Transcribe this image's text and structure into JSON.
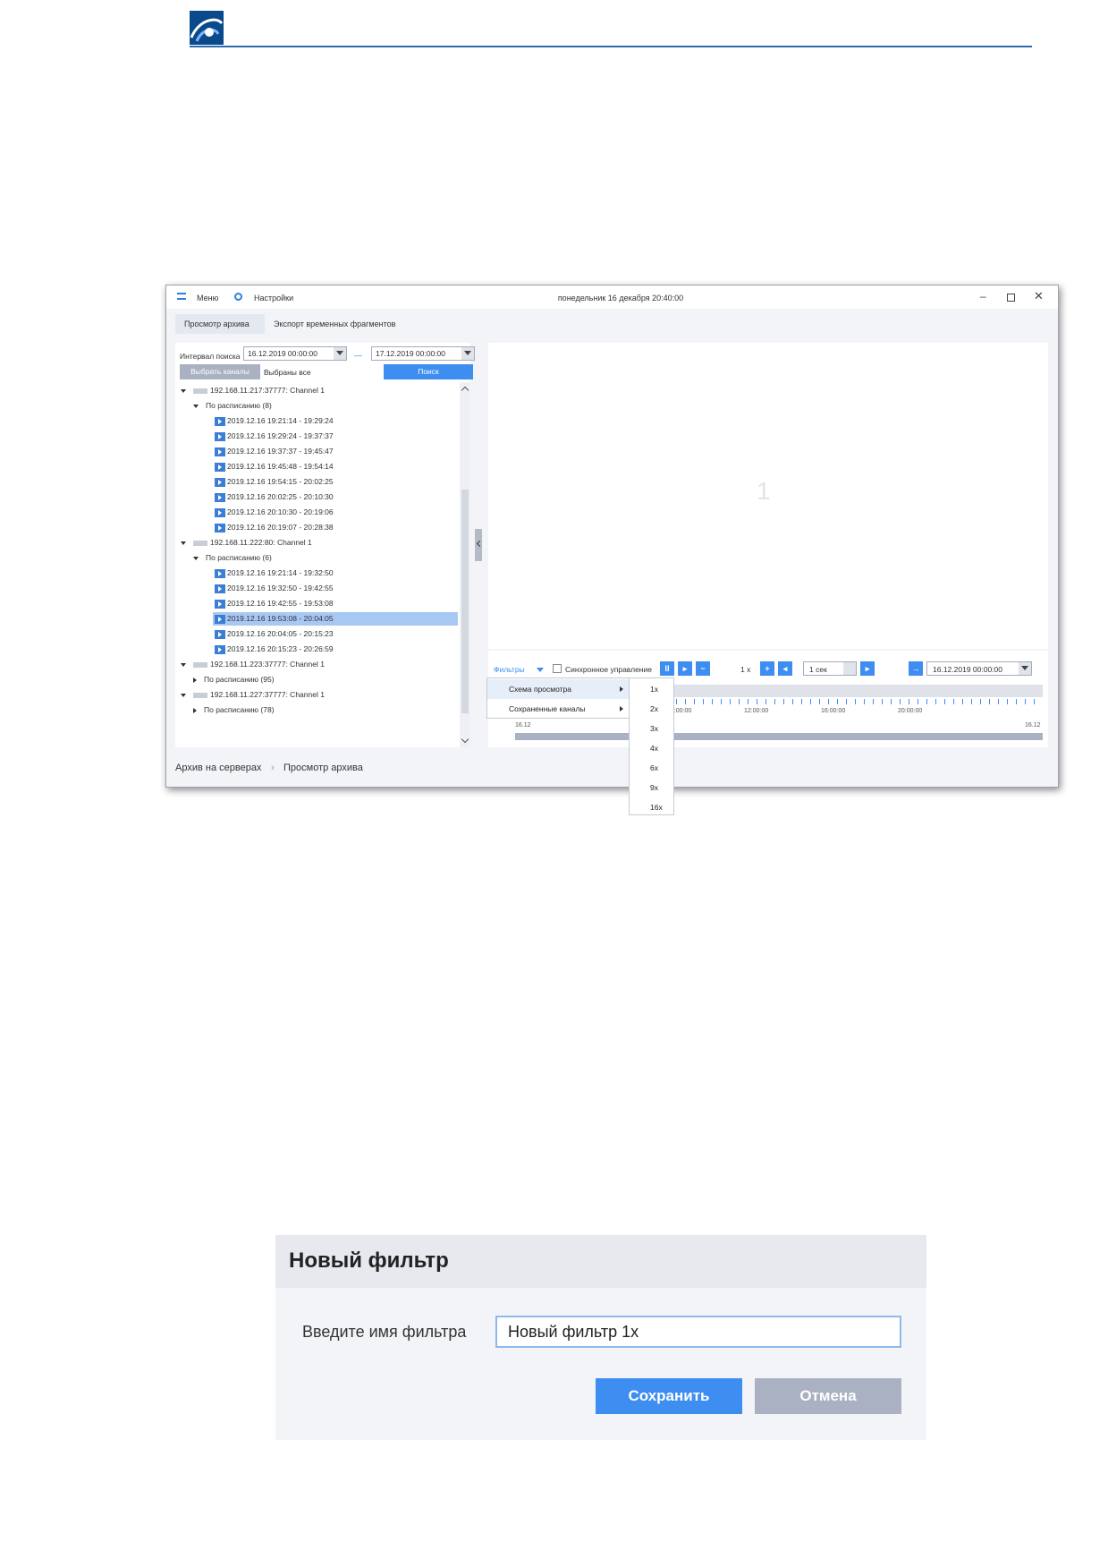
{
  "colors": {
    "accent": "#3d8ef0",
    "header_rule": "#2e6ab1",
    "logo": "#0a4a8c",
    "selection": "#a8c8f4",
    "disabled_button": "#a9b1c2"
  },
  "doc": {
    "logo_icon": "logo-icon"
  },
  "app": {
    "menu_label": "Меню",
    "settings_label": "Настройки",
    "datetime": "понедельник 16 декабря 20:40:00",
    "window_icons": [
      "minimize-icon",
      "maximize-icon",
      "close-icon"
    ],
    "tabs": [
      {
        "label": "Просмотр архива",
        "active": true
      },
      {
        "label": "Экспорт временных фрагментов",
        "active": false
      }
    ],
    "search": {
      "interval_label": "Интервал поиска",
      "date_from": "16.12.2019  00:00:00",
      "date_to": "17.12.2019  00:00:00",
      "select_channels": "Выбрать каналы",
      "selected_all": "Выбраны все",
      "search_button": "Поиск"
    },
    "tree": [
      {
        "type": "channel",
        "label": "192.168.11.217:37777: Channel 1",
        "expanded": true
      },
      {
        "type": "group",
        "label": "По расписанию (8)",
        "expanded": true
      },
      {
        "type": "record",
        "label": "2019.12.16   19:21:14 - 19:29:24"
      },
      {
        "type": "record",
        "label": "2019.12.16   19:29:24 - 19:37:37"
      },
      {
        "type": "record",
        "label": "2019.12.16   19:37:37 - 19:45:47"
      },
      {
        "type": "record",
        "label": "2019.12.16   19:45:48 - 19:54:14"
      },
      {
        "type": "record",
        "label": "2019.12.16   19:54:15 - 20:02:25"
      },
      {
        "type": "record",
        "label": "2019.12.16   20:02:25 - 20:10:30"
      },
      {
        "type": "record",
        "label": "2019.12.16   20:10:30 - 20:19:06"
      },
      {
        "type": "record",
        "label": "2019.12.16   20:19:07 - 20:28:38"
      },
      {
        "type": "channel",
        "label": "192.168.11.222:80: Channel 1",
        "expanded": true
      },
      {
        "type": "group",
        "label": "По расписанию (6)",
        "expanded": true
      },
      {
        "type": "record",
        "label": "2019.12.16   19:21:14 - 19:32:50"
      },
      {
        "type": "record",
        "label": "2019.12.16   19:32:50 - 19:42:55"
      },
      {
        "type": "record",
        "label": "2019.12.16   19:42:55 - 19:53:08"
      },
      {
        "type": "record",
        "label": "2019.12.16   19:53:08 - 20:04:05",
        "selected": true
      },
      {
        "type": "record",
        "label": "2019.12.16   20:04:05 - 20:15:23"
      },
      {
        "type": "record",
        "label": "2019.12.16   20:15:23 - 20:26:59"
      },
      {
        "type": "channel",
        "label": "192.168.11.223:37777: Channel 1",
        "expanded": true
      },
      {
        "type": "group",
        "label": "По расписанию (95)",
        "expanded": false
      },
      {
        "type": "channel",
        "label": "192.168.11.227:37777: Channel 1",
        "expanded": true
      },
      {
        "type": "group",
        "label": "По расписанию (78)",
        "expanded": false
      }
    ],
    "video_slot": "1",
    "controls": {
      "filters_label": "Фильтры",
      "sync_label": "Синхронное управление",
      "sync_checked": false,
      "speed_value": "1 x",
      "step_value": "1 сек",
      "goto_date": "16.12.2019  00:00:00",
      "timeline_labels": [
        "08:00:00",
        "12:00:00",
        "16:00:00",
        "20:00:00"
      ],
      "range_start": "16.12",
      "range_end": "16.12"
    },
    "filters_menu": [
      {
        "label": "Схема просмотра",
        "highlighted": true
      },
      {
        "label": "Сохраненные каналы",
        "highlighted": false
      }
    ],
    "speed_menu": [
      "1x",
      "2x",
      "3x",
      "4x",
      "6x",
      "9x",
      "16x"
    ],
    "breadcrumb": [
      "Архив на серверах",
      "Просмотр архива"
    ]
  },
  "dialog": {
    "title": "Новый фильтр",
    "name_label": "Введите имя фильтра",
    "name_value": "Новый фильтр 1x",
    "save_label": "Сохранить",
    "cancel_label": "Отмена"
  }
}
